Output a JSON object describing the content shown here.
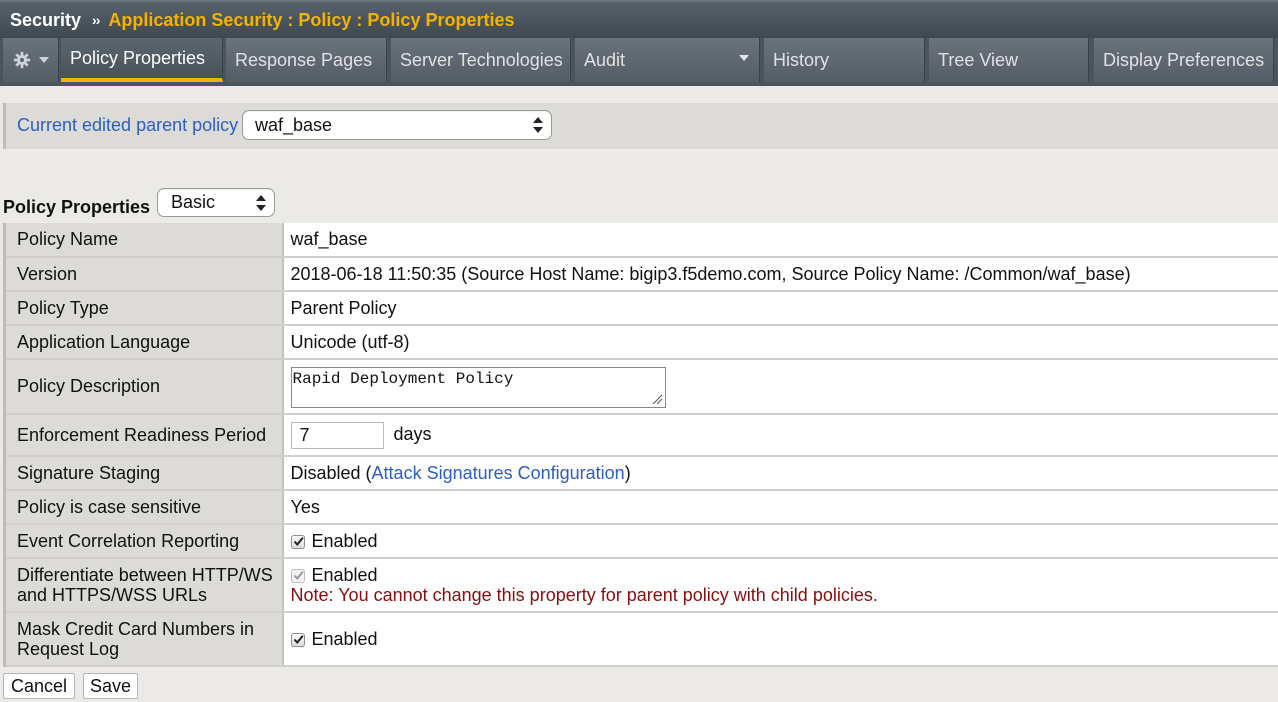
{
  "header": {
    "root": "Security",
    "separator": "››",
    "path": "Application Security : Policy : Policy Properties"
  },
  "tabs": [
    {
      "label": "Policy Properties",
      "active": true
    },
    {
      "label": "Response Pages"
    },
    {
      "label": "Server Technologies"
    },
    {
      "label": "Audit",
      "has_dropdown": true
    },
    {
      "label": "History"
    },
    {
      "label": "Tree View"
    },
    {
      "label": "Display Preferences"
    }
  ],
  "parent_policy": {
    "label": "Current edited parent policy",
    "value": "waf_base"
  },
  "section": {
    "title": "Policy Properties",
    "view_select": "Basic"
  },
  "rows": {
    "policy_name": {
      "label": "Policy Name",
      "value": "waf_base"
    },
    "version": {
      "label": "Version",
      "value": "2018-06-18 11:50:35 (Source Host Name: bigip3.f5demo.com, Source Policy Name: /Common/waf_base)"
    },
    "policy_type": {
      "label": "Policy Type",
      "value": "Parent Policy"
    },
    "app_language": {
      "label": "Application Language",
      "value": "Unicode (utf-8)"
    },
    "description": {
      "label": "Policy Description",
      "value": "Rapid Deployment Policy"
    },
    "enforcement": {
      "label": "Enforcement Readiness Period",
      "value": "7",
      "unit": "days"
    },
    "sig_staging": {
      "label": "Signature Staging",
      "value": "Disabled (",
      "link": "Attack Signatures Configuration",
      "close": ")"
    },
    "case_sensitive": {
      "label": "Policy is case sensitive",
      "value": "Yes"
    },
    "event_correlation": {
      "label": "Event Correlation Reporting",
      "checkbox": "Enabled",
      "checked": true
    },
    "differentiate": {
      "label_line1": "Differentiate between HTTP/WS",
      "label_line2": "and HTTPS/WSS URLs",
      "checkbox": "Enabled",
      "checked": true,
      "note": "Note: You cannot change this property for parent policy with child policies."
    },
    "mask_cc": {
      "label_line1": "Mask Credit Card Numbers in",
      "label_line2": "Request Log",
      "checkbox": "Enabled",
      "checked": true
    }
  },
  "buttons": {
    "cancel": "Cancel",
    "save": "Save"
  },
  "colors": {
    "accent": "#f5b300",
    "link": "#2c5fbf",
    "note": "#8a0d0d"
  }
}
